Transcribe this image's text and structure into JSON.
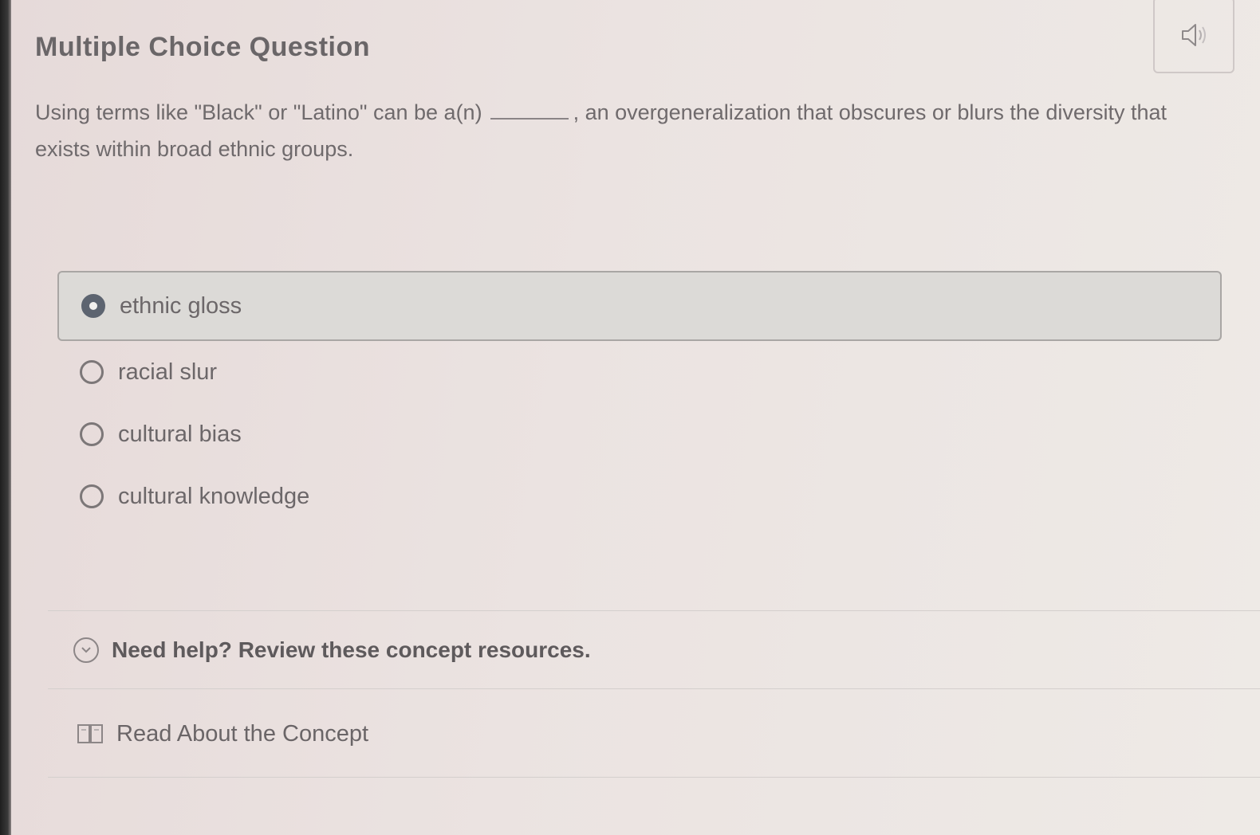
{
  "question": {
    "title": "Multiple Choice Question",
    "prompt_before_blank": "Using terms like \"Black\" or \"Latino\" can be a(n)",
    "prompt_after_blank": ", an overgeneralization that obscures or blurs the diversity that exists within broad ethnic groups."
  },
  "audio": {
    "icon": "speaker-icon"
  },
  "options": [
    {
      "label": "ethnic gloss",
      "selected": true
    },
    {
      "label": "racial slur",
      "selected": false
    },
    {
      "label": "cultural bias",
      "selected": false
    },
    {
      "label": "cultural knowledge",
      "selected": false
    }
  ],
  "help": {
    "title": "Need help? Review these concept resources.",
    "icon": "chevron-down-circle-icon",
    "resources": [
      {
        "label": "Read About the Concept",
        "icon": "book-icon"
      }
    ]
  },
  "colors": {
    "selected_radio": "#5d6470",
    "selected_background": "#dcdad7",
    "text": "#6c6769"
  }
}
